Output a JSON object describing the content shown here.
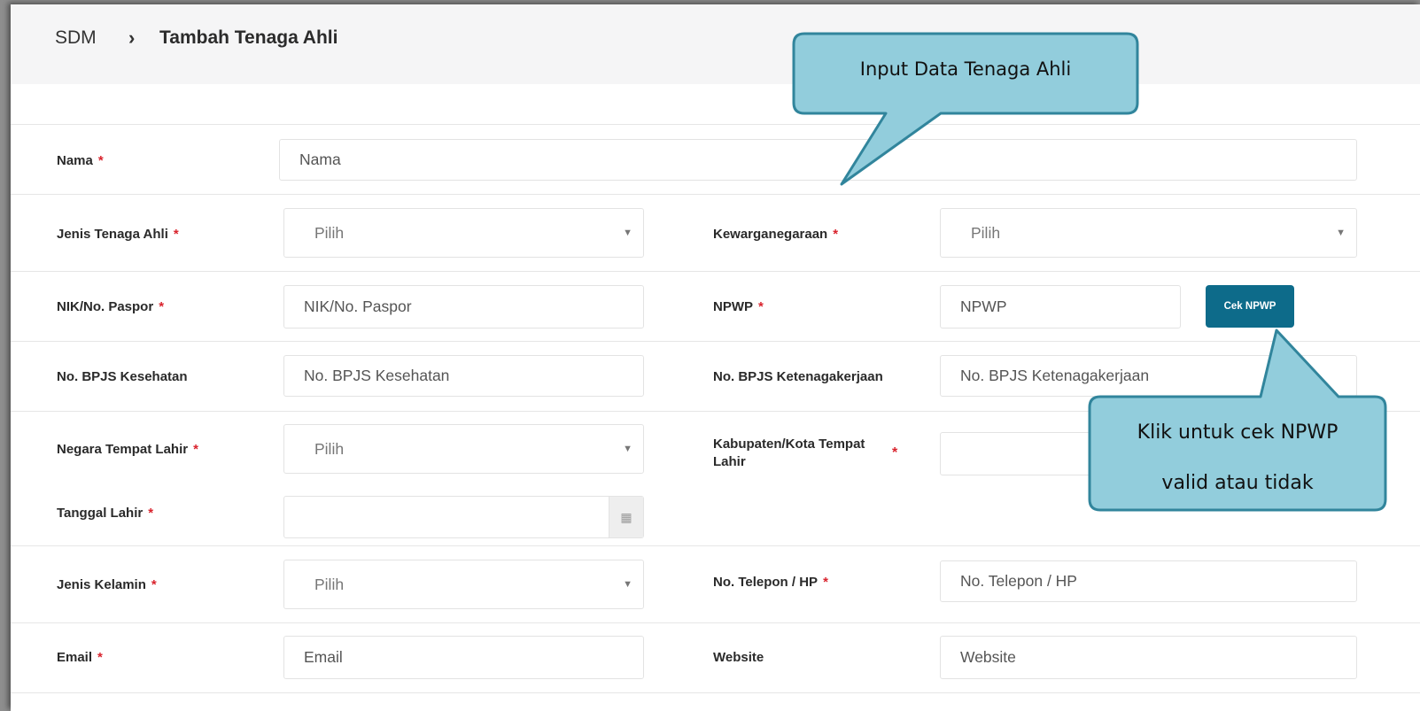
{
  "breadcrumb": {
    "root": "SDM",
    "separator": "›",
    "current": "Tambah Tenaga Ahli"
  },
  "required_mark": "*",
  "form": {
    "nama": {
      "label": "Nama",
      "placeholder": "Nama"
    },
    "jenis_tenaga_ahli": {
      "label": "Jenis Tenaga Ahli",
      "value": "Pilih"
    },
    "kewarganegaraan": {
      "label": "Kewarganegaraan",
      "value": "Pilih"
    },
    "nik": {
      "label": "NIK/No. Paspor",
      "placeholder": "NIK/No. Paspor"
    },
    "npwp": {
      "label": "NPWP",
      "placeholder": "NPWP",
      "button": "Cek NPWP"
    },
    "bpjs_kesehatan": {
      "label": "No. BPJS Kesehatan",
      "placeholder": "No. BPJS Kesehatan"
    },
    "bpjs_ketenagakerjaan": {
      "label": "No. BPJS Ketenagakerjaan",
      "placeholder": "No. BPJS Ketenagakerjaan"
    },
    "negara_tempat_lahir": {
      "label": "Negara Tempat Lahir",
      "value": "Pilih"
    },
    "kabupaten_tempat_lahir": {
      "label_line1": "Kabupaten/Kota Tempat",
      "label_line2": "Lahir"
    },
    "tanggal_lahir": {
      "label": "Tanggal Lahir"
    },
    "jenis_kelamin": {
      "label": "Jenis Kelamin",
      "value": "Pilih"
    },
    "telepon": {
      "label": "No. Telepon / HP",
      "placeholder": "No. Telepon / HP"
    },
    "email": {
      "label": "Email",
      "placeholder": "Email"
    },
    "website": {
      "label": "Website",
      "placeholder": "Website"
    }
  },
  "callouts": {
    "input": {
      "text": "Input Data Tenaga Ahli"
    },
    "npwp": {
      "line1": "Klik untuk cek NPWP",
      "line2": "valid atau tidak"
    }
  },
  "colors": {
    "button": "#0d6b8a",
    "required": "#d9232d",
    "callout_fill": "#92cddc",
    "callout_border": "#31859c"
  }
}
